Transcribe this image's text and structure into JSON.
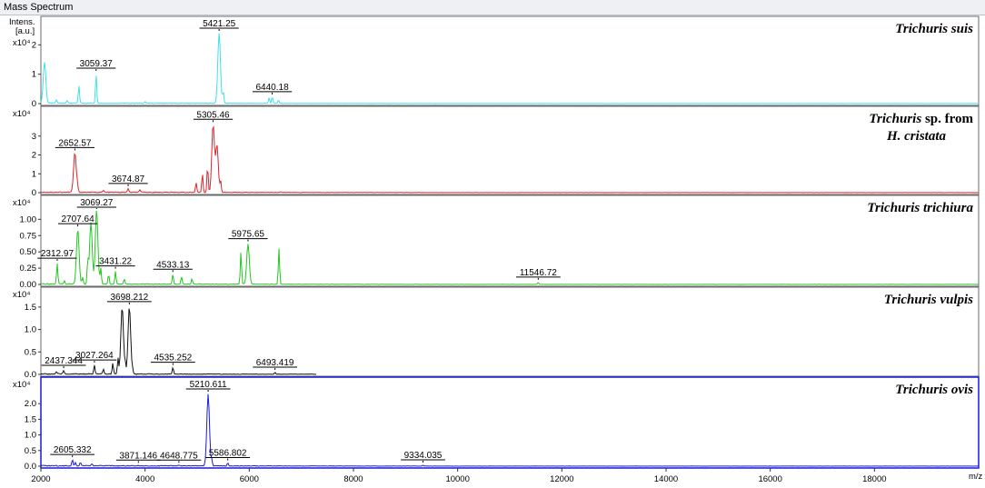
{
  "window": {
    "title": "Mass Spectrum"
  },
  "y_axis_title_line1": "Intens.",
  "y_axis_title_line2": "[a.u.]",
  "x_axis_unit": "m/z",
  "chart_data": {
    "type": "line",
    "title": "",
    "xlabel": "m/z",
    "ylabel": "Intens. [a.u.]",
    "xlim": [
      2000,
      20000
    ],
    "x_ticks": [
      2000,
      4000,
      6000,
      8000,
      10000,
      12000,
      14000,
      16000,
      18000
    ],
    "x_tick_labels": [
      "2000",
      "4000",
      "6000",
      "8000",
      "10000",
      "12000",
      "14000",
      "16000",
      "18000"
    ],
    "panels": [
      {
        "species": "Trichuris suis",
        "species_line2": "",
        "scale_label": "x10⁴",
        "color": "#3ee0e8",
        "ylim": [
          0,
          2.6
        ],
        "y_ticks": [
          0,
          1,
          2
        ],
        "y_tick_labels": [
          "0",
          "1",
          "2"
        ],
        "peaks": [
          {
            "mz": 2070,
            "intensity": 1.4
          },
          {
            "mz": 2300,
            "intensity": 0.12
          },
          {
            "mz": 2500,
            "intensity": 0.1
          },
          {
            "mz": 2730,
            "intensity": 0.6
          },
          {
            "mz": 3059.37,
            "intensity": 1.02
          },
          {
            "mz": 4000,
            "intensity": 0.06
          },
          {
            "mz": 5421.25,
            "intensity": 2.4
          },
          {
            "mz": 5500,
            "intensity": 0.4
          },
          {
            "mz": 6380,
            "intensity": 0.18
          },
          {
            "mz": 6440.18,
            "intensity": 0.22
          },
          {
            "mz": 6560,
            "intensity": 0.12
          }
        ],
        "labels": [
          {
            "mz": 3059.37,
            "text": "3059.37",
            "intensity": 1.02
          },
          {
            "mz": 5421.25,
            "text": "5421.25",
            "intensity": 2.4
          },
          {
            "mz": 6440.18,
            "text": "6440.18",
            "intensity": 0.22
          }
        ]
      },
      {
        "species": "Trichuris",
        "species_suffix": " sp. from",
        "species_line2": "H. cristata",
        "scale_label": "x10⁴",
        "color": "#e0242a",
        "ylim": [
          0,
          4.0
        ],
        "y_ticks": [
          0,
          1,
          2,
          3
        ],
        "y_tick_labels": [
          "0",
          "1",
          "2",
          "3"
        ],
        "peaks": [
          {
            "mz": 2652.57,
            "intensity": 2.1
          },
          {
            "mz": 2700,
            "intensity": 0.3
          },
          {
            "mz": 3200,
            "intensity": 0.1
          },
          {
            "mz": 3674.87,
            "intensity": 0.2
          },
          {
            "mz": 3900,
            "intensity": 0.15
          },
          {
            "mz": 4980,
            "intensity": 0.5
          },
          {
            "mz": 5100,
            "intensity": 1.0
          },
          {
            "mz": 5200,
            "intensity": 1.4
          },
          {
            "mz": 5305.46,
            "intensity": 3.6
          },
          {
            "mz": 5380,
            "intensity": 2.5
          },
          {
            "mz": 5450,
            "intensity": 0.6
          },
          {
            "mz": 6600,
            "intensity": 0.05
          }
        ],
        "labels": [
          {
            "mz": 2652.57,
            "text": "2652.57",
            "intensity": 2.1
          },
          {
            "mz": 3674.87,
            "text": "3674.87",
            "intensity": 0.2
          },
          {
            "mz": 5305.46,
            "text": "5305.46",
            "intensity": 3.6
          }
        ]
      },
      {
        "species": "Trichuris trichiura",
        "species_line2": "",
        "scale_label": "x10⁴",
        "color": "#22c81e",
        "ylim": [
          0,
          1.2
        ],
        "y_ticks": [
          0,
          0.25,
          0.5,
          0.75,
          1.0
        ],
        "y_tick_labels": [
          "0.00",
          "0.25",
          "0.50",
          "0.75",
          "1.00"
        ],
        "peaks": [
          {
            "mz": 2312.97,
            "intensity": 0.32
          },
          {
            "mz": 2450,
            "intensity": 0.05
          },
          {
            "mz": 2707.64,
            "intensity": 0.85
          },
          {
            "mz": 2800,
            "intensity": 0.1
          },
          {
            "mz": 2900,
            "intensity": 0.35
          },
          {
            "mz": 2960,
            "intensity": 0.95
          },
          {
            "mz": 3069.27,
            "intensity": 1.15
          },
          {
            "mz": 3150,
            "intensity": 0.25
          },
          {
            "mz": 3300,
            "intensity": 0.15
          },
          {
            "mz": 3431.22,
            "intensity": 0.2
          },
          {
            "mz": 3600,
            "intensity": 0.08
          },
          {
            "mz": 4533.13,
            "intensity": 0.15
          },
          {
            "mz": 4700,
            "intensity": 0.12
          },
          {
            "mz": 4900,
            "intensity": 0.08
          },
          {
            "mz": 5840,
            "intensity": 0.5
          },
          {
            "mz": 5975.65,
            "intensity": 0.62
          },
          {
            "mz": 6570,
            "intensity": 0.55
          },
          {
            "mz": 11546.72,
            "intensity": 0.03
          }
        ],
        "labels": [
          {
            "mz": 2312.97,
            "text": "2312.97",
            "intensity": 0.32
          },
          {
            "mz": 2707.64,
            "text": "2707.64",
            "intensity": 0.85
          },
          {
            "mz": 3069.27,
            "text": "3069.27",
            "intensity": 1.15
          },
          {
            "mz": 3431.22,
            "text": "3431.22",
            "intensity": 0.2
          },
          {
            "mz": 4533.13,
            "text": "4533.13",
            "intensity": 0.15
          },
          {
            "mz": 5975.65,
            "text": "5975.65",
            "intensity": 0.62
          },
          {
            "mz": 11546.72,
            "text": "11546.72",
            "intensity": 0.03
          }
        ]
      },
      {
        "species": "Trichuris vulpis",
        "species_line2": "",
        "scale_label": "x10⁴",
        "color": "#111111",
        "ylim": [
          0,
          1.7
        ],
        "y_ticks": [
          0,
          0.5,
          1.0,
          1.5
        ],
        "y_tick_labels": [
          "0.0",
          "0.5",
          "1.0",
          "1.5"
        ],
        "peaks": [
          {
            "mz": 2300,
            "intensity": 0.05
          },
          {
            "mz": 2437.344,
            "intensity": 0.08
          },
          {
            "mz": 3027.264,
            "intensity": 0.2
          },
          {
            "mz": 3200,
            "intensity": 0.1
          },
          {
            "mz": 3380,
            "intensity": 0.25
          },
          {
            "mz": 3480,
            "intensity": 0.35
          },
          {
            "mz": 3560,
            "intensity": 1.5
          },
          {
            "mz": 3620,
            "intensity": 0.2
          },
          {
            "mz": 3698.212,
            "intensity": 1.5
          },
          {
            "mz": 3760,
            "intensity": 0.1
          },
          {
            "mz": 4535.252,
            "intensity": 0.15
          },
          {
            "mz": 6493.419,
            "intensity": 0.04
          }
        ],
        "labels": [
          {
            "mz": 2437.344,
            "text": "2437.344",
            "intensity": 0.08
          },
          {
            "mz": 3027.264,
            "text": "3027.264",
            "intensity": 0.2
          },
          {
            "mz": 3698.212,
            "text": "3698.212",
            "intensity": 1.5
          },
          {
            "mz": 4535.252,
            "text": "4535.252",
            "intensity": 0.15
          },
          {
            "mz": 6493.419,
            "text": "6493.419",
            "intensity": 0.04
          }
        ]
      },
      {
        "species": "Trichuris ovis",
        "species_line2": "",
        "scale_label": "x10⁴",
        "color": "#1a1ad8",
        "ylim": [
          0,
          2.5
        ],
        "y_ticks": [
          0,
          0.5,
          1.0,
          1.5,
          2.0
        ],
        "y_tick_labels": [
          "0.0",
          "0.5",
          "1.0",
          "1.5",
          "2.0"
        ],
        "peaks": [
          {
            "mz": 2605.332,
            "intensity": 0.2
          },
          {
            "mz": 2660,
            "intensity": 0.1
          },
          {
            "mz": 2760,
            "intensity": 0.12
          },
          {
            "mz": 2980,
            "intensity": 0.06
          },
          {
            "mz": 3871.146,
            "intensity": 0.02
          },
          {
            "mz": 4648.775,
            "intensity": 0.02
          },
          {
            "mz": 5210.611,
            "intensity": 2.3
          },
          {
            "mz": 5280,
            "intensity": 0.2
          },
          {
            "mz": 5586.802,
            "intensity": 0.1
          },
          {
            "mz": 9334.035,
            "intensity": 0.03
          }
        ],
        "labels": [
          {
            "mz": 2605.332,
            "text": "2605.332",
            "intensity": 0.2
          },
          {
            "mz": 3871.146,
            "text": "3871.146",
            "intensity": 0.02
          },
          {
            "mz": 4648.775,
            "text": "4648.775",
            "intensity": 0.02
          },
          {
            "mz": 5210.611,
            "text": "5210.611",
            "intensity": 2.3
          },
          {
            "mz": 5586.802,
            "text": "5586.802",
            "intensity": 0.1
          },
          {
            "mz": 9334.035,
            "text": "9334.035",
            "intensity": 0.03
          }
        ]
      }
    ]
  }
}
